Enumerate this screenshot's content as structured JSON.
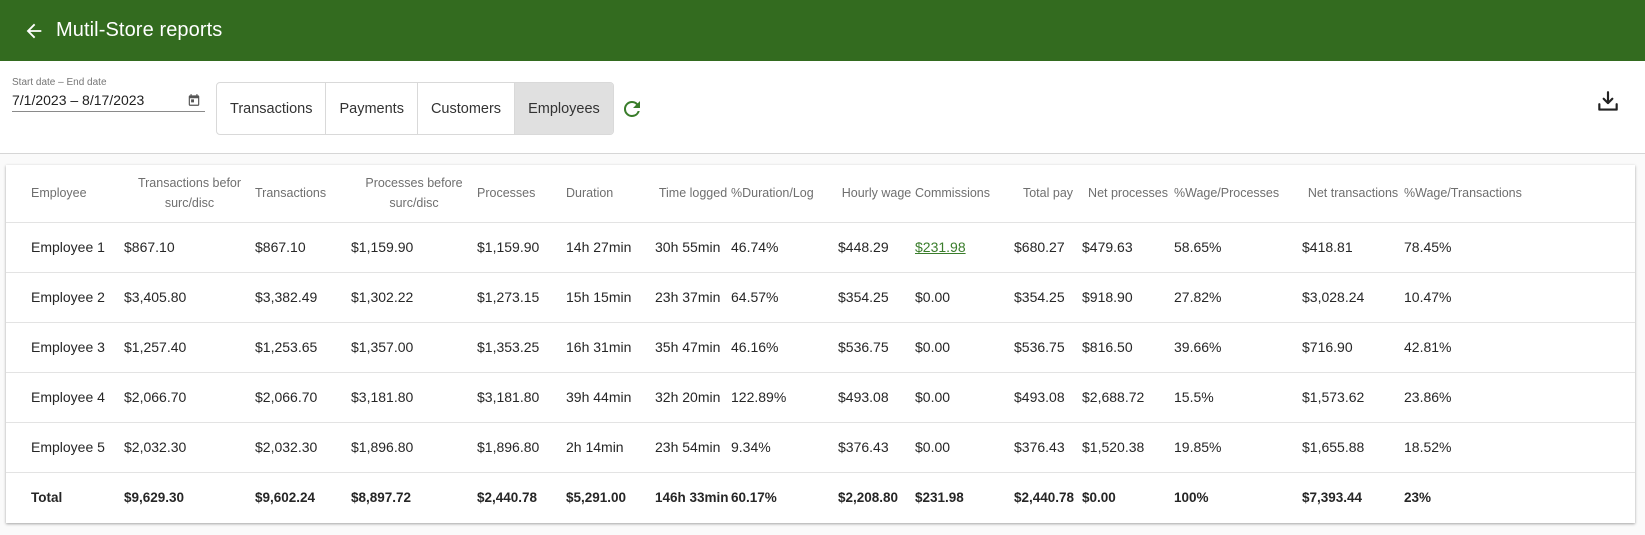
{
  "header": {
    "title": "Mutil-Store reports"
  },
  "filters": {
    "date_label": "Start date – End date",
    "date_value": "7/1/2023 – 8/17/2023"
  },
  "tabs": [
    "Transactions",
    "Payments",
    "Customers",
    "Employees"
  ],
  "active_tab": "Employees",
  "icons": {
    "back": "arrow-left-icon",
    "calendar": "calendar-icon",
    "refresh": "refresh-icon",
    "download": "download-icon"
  },
  "colors": {
    "appbar": "#336b1f",
    "accent": "#3a7d2b",
    "active_tab": "#e0e0e0"
  },
  "table": {
    "columns": [
      "Employee",
      "Transactions befor surc/disc",
      "Transactions",
      "Processes before surc/disc",
      "Processes",
      "Duration",
      "Time logged",
      "%Duration/Log",
      "Hourly wage",
      "Commissions",
      "Total pay",
      "Net processes",
      "%Wage/Processes",
      "Net transactions",
      "%Wage/Transactions"
    ],
    "rows": [
      [
        "Employee 1",
        "$867.10",
        "$867.10",
        "$1,159.90",
        "$1,159.90",
        "14h 27min",
        "30h 55min",
        "46.74%",
        "$448.29",
        "$231.98",
        "$680.27",
        "$479.63",
        "58.65%",
        "$418.81",
        "78.45%"
      ],
      [
        "Employee 2",
        "$3,405.80",
        "$3,382.49",
        "$1,302.22",
        "$1,273.15",
        "15h 15min",
        "23h 37min",
        "64.57%",
        "$354.25",
        "$0.00",
        "$354.25",
        "$918.90",
        "27.82%",
        "$3,028.24",
        "10.47%"
      ],
      [
        "Employee 3",
        "$1,257.40",
        "$1,253.65",
        "$1,357.00",
        "$1,353.25",
        "16h 31min",
        "35h 47min",
        "46.16%",
        "$536.75",
        "$0.00",
        "$536.75",
        "$816.50",
        "39.66%",
        "$716.90",
        "42.81%"
      ],
      [
        "Employee 4",
        "$2,066.70",
        "$2,066.70",
        "$3,181.80",
        "$3,181.80",
        "39h 44min",
        "32h 20min",
        "122.89%",
        "$493.08",
        "$0.00",
        "$493.08",
        "$2,688.72",
        "15.5%",
        "$1,573.62",
        "23.86%"
      ],
      [
        "Employee 5",
        "$2,032.30",
        "$2,032.30",
        "$1,896.80",
        "$1,896.80",
        "2h 14min",
        "23h 54min",
        "9.34%",
        "$376.43",
        "$0.00",
        "$376.43",
        "$1,520.38",
        "19.85%",
        "$1,655.88",
        "18.52%"
      ]
    ],
    "total": [
      "Total",
      "$9,629.30",
      "$9,602.24",
      "$8,897.72",
      "$2,440.78",
      "$5,291.00",
      "146h 33min",
      "60.17%",
      "$2,208.80",
      "$231.98",
      "$2,440.78",
      "$0.00",
      "100%",
      "$7,393.44",
      "23%"
    ]
  }
}
